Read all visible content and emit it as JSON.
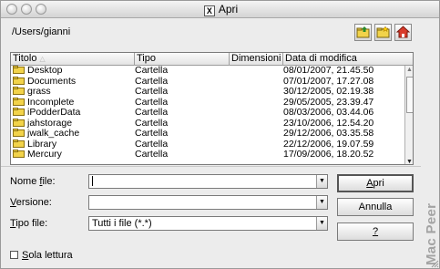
{
  "window": {
    "title": "Apri",
    "x_badge": "X"
  },
  "path": "/Users/gianni",
  "toolbar": {
    "up_icon": "folder-up-icon",
    "new_folder_icon": "new-folder-icon",
    "home_icon": "home-icon"
  },
  "table": {
    "columns": [
      "Titolo",
      "Tipo",
      "Dimensioni",
      "Data di modifica"
    ],
    "sort_indicator": "△",
    "rows": [
      {
        "name": "Desktop",
        "type": "Cartella",
        "size": "",
        "date": "08/01/2007, 21.45.50"
      },
      {
        "name": "Documents",
        "type": "Cartella",
        "size": "",
        "date": "07/01/2007, 17.27.08"
      },
      {
        "name": "grass",
        "type": "Cartella",
        "size": "",
        "date": "30/12/2005, 02.19.38"
      },
      {
        "name": "Incomplete",
        "type": "Cartella",
        "size": "",
        "date": "29/05/2005, 23.39.47"
      },
      {
        "name": "iPodderData",
        "type": "Cartella",
        "size": "",
        "date": "08/03/2006, 03.44.06"
      },
      {
        "name": "jahstorage",
        "type": "Cartella",
        "size": "",
        "date": "23/10/2006, 12.54.20"
      },
      {
        "name": "jwalk_cache",
        "type": "Cartella",
        "size": "",
        "date": "29/12/2006, 03.35.58"
      },
      {
        "name": "Library",
        "type": "Cartella",
        "size": "",
        "date": "22/12/2006, 19.07.59"
      },
      {
        "name": "Mercury",
        "type": "Cartella",
        "size": "",
        "date": "17/09/2006, 18.20.52"
      }
    ]
  },
  "form": {
    "filename_label_u": "N",
    "filename_label_rest": "ome file:",
    "filename_label_pre": "Nome ",
    "filename_label_key": "f",
    "filename_label_post": "ile:",
    "version_label_key": "V",
    "version_label_post": "ersione:",
    "filetype_label_key": "T",
    "filetype_label_post": "ipo file:",
    "filename_value": "",
    "version_value": "",
    "filetype_value": "Tutti i file (*.*)",
    "readonly_key": "S",
    "readonly_post": "ola lettura"
  },
  "buttons": {
    "open_key": "A",
    "open_post": "pri",
    "cancel": "Annulla",
    "help_key": "?"
  },
  "watermark": "Mac Peer"
}
